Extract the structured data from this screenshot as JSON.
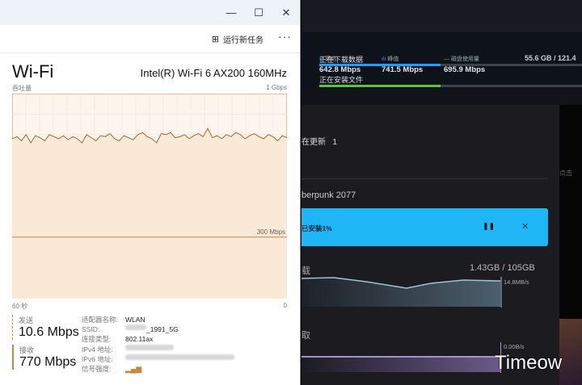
{
  "task_manager": {
    "window_controls": {
      "minimize": "—",
      "maximize": "☐",
      "close": "✕"
    },
    "run_new_task": "运行新任务",
    "more": "···",
    "title": "Wi-Fi",
    "adapter": "Intel(R) Wi-Fi 6 AX200 160MHz",
    "throughput_label": "吞吐量",
    "max_label": "1 Gbps",
    "ref_label": "300 Mbps",
    "time_left": "60 秒",
    "time_right": "0",
    "send_label": "发送",
    "send_value": "10.6 Mbps",
    "recv_label": "接收",
    "recv_value": "770 Mbps",
    "props": [
      {
        "k": "适配器名称:",
        "v": "WLAN"
      },
      {
        "k": "SSID:",
        "v": "_1991_5G"
      },
      {
        "k": "连接类型:",
        "v": "802.11ax"
      },
      {
        "k": "IPv4 地址:",
        "v": ""
      },
      {
        "k": "IPv6 地址:",
        "v": ""
      },
      {
        "k": "信号强度:",
        "v": ""
      }
    ]
  },
  "chart_data": {
    "type": "area",
    "title": "吞吐量",
    "ylim": [
      0,
      1000
    ],
    "yunit": "Mbps",
    "xlabel": "60 秒",
    "reference_line": 300,
    "values": [
      780,
      790,
      770,
      800,
      760,
      795,
      785,
      770,
      800,
      790,
      780,
      795,
      775,
      790,
      780,
      760,
      800,
      785,
      770,
      795,
      790,
      805,
      780,
      770,
      795,
      785,
      775,
      800,
      810,
      790,
      780,
      760,
      805,
      800,
      810,
      785,
      790,
      800,
      780,
      795,
      805,
      790,
      830,
      785,
      795,
      780,
      800,
      790,
      810,
      800,
      780,
      795,
      805,
      790,
      780,
      800,
      790,
      770,
      795,
      785
    ]
  },
  "steam": {
    "network_label": "网络",
    "network_value": "642.8 Mbps",
    "peak_label": "峰值",
    "peak_value": "741.5 Mbps",
    "disk_label": "磁盘使用量",
    "disk_value": "695.9 Mbps",
    "downloading_label": "正在下载数据",
    "downloading_value": "55.6 GB / 121.4",
    "download_progress": 0.46,
    "installing_label": "正在安装文件",
    "install_progress": 0.46,
    "updating_label": "在更新",
    "updating_count": "1",
    "game": "berpunk 2077",
    "side_hint": "点击",
    "banner_text": "已安装1%",
    "pause": "❚❚",
    "close": "✕",
    "download_section": "载",
    "download_size": "1.43GB / 105GB",
    "download_rate": "14.8MB/s",
    "disk_section": "取",
    "disk_rate": "0.00B/s",
    "colors": {
      "accent": "#1fb6f5",
      "download_bar": "#1a9fff",
      "install_bar": "#5ac43c"
    }
  },
  "watermark": "Timeow"
}
